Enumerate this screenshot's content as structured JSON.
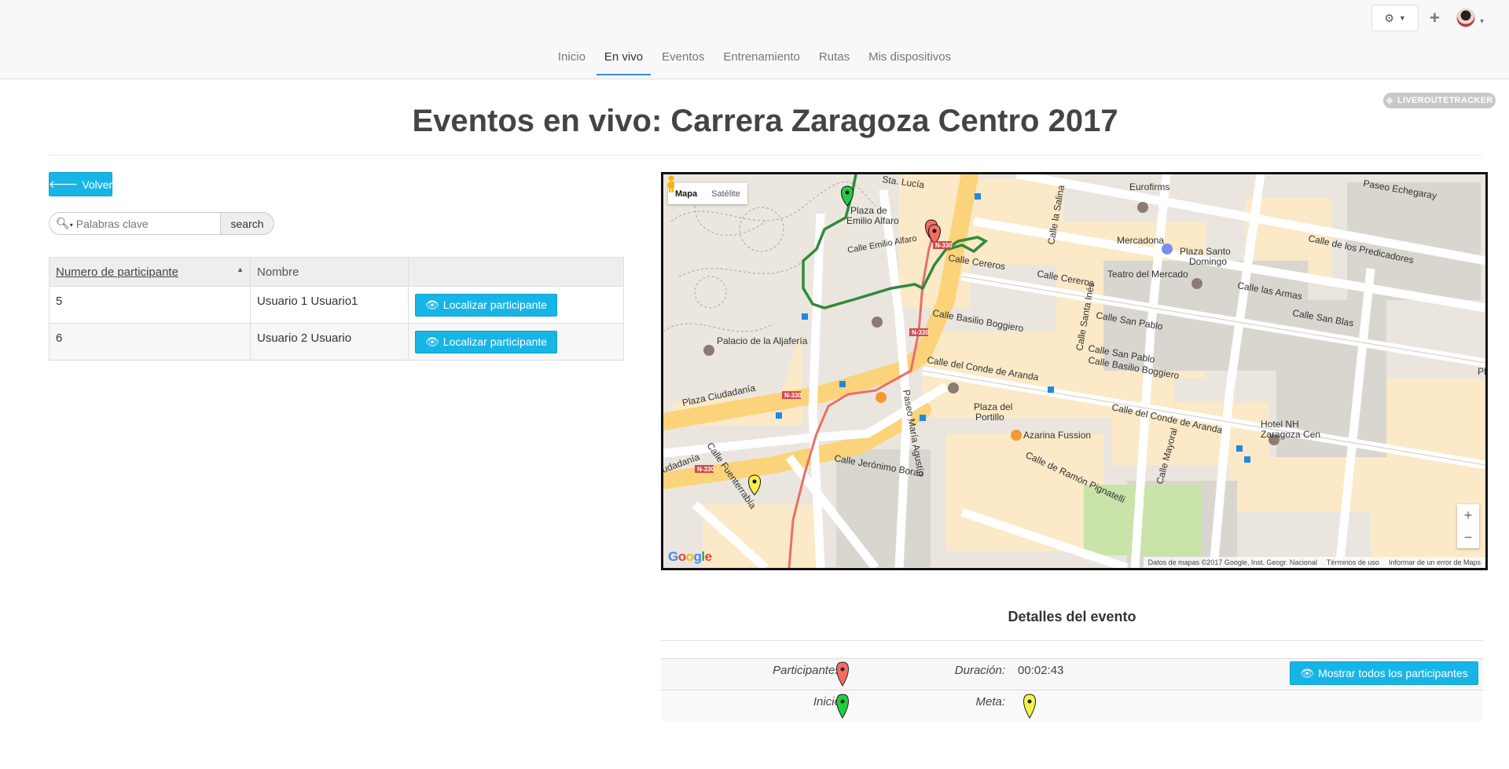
{
  "nav": {
    "items": [
      {
        "label": "Inicio",
        "active": false
      },
      {
        "label": "En vivo",
        "active": true
      },
      {
        "label": "Eventos",
        "active": false
      },
      {
        "label": "Entrenamiento",
        "active": false
      },
      {
        "label": "Rutas",
        "active": false
      },
      {
        "label": "Mis dispositivos",
        "active": false
      }
    ],
    "settings_icon": "gear-icon",
    "add_icon": "plus-icon"
  },
  "brand_badge": "LIVEROUTETRACKER",
  "page_title": "Eventos en vivo: Carrera Zaragoza Centro 2017",
  "back_button": "Volver",
  "search": {
    "placeholder": "Palabras clave",
    "button_label": "search"
  },
  "table": {
    "headers": [
      "Numero de participante",
      "Nombre",
      ""
    ],
    "sort_column": "Numero de participante",
    "rows": [
      {
        "number": "5",
        "name": "Usuario 1 Usuario1",
        "action": "Localizar participante"
      },
      {
        "number": "6",
        "name": "Usuario 2 Usuario",
        "action": "Localizar participante"
      }
    ]
  },
  "map": {
    "type_buttons": {
      "map": "Mapa",
      "satellite": "Satélite"
    },
    "labels": [
      "Sta. Lucía",
      "Eurofirms",
      "Paseo Echegaray",
      "Plaza de",
      "Emilio Alfaro",
      "Calle Emilio Alfaro",
      "Mercadona",
      "Plaza Santo",
      "Domingo",
      "Calle de los Predicadores",
      "Calle Cereros",
      "Calle Cereros",
      "Teatro del Mercado",
      "Calle las Armas",
      "Calle Basilio Boggiero",
      "Calle San Pablo",
      "Calle San Blas",
      "Palacio de la Aljafería",
      "Calle San Pablo",
      "Calle del Conde de Aranda",
      "Calle Basilio Boggiero",
      "Plaza Ciudadanía",
      "Paseo María Agustín",
      "Plaza del",
      "Portillo",
      "Calle del Conde de Aranda",
      "Azarina Fussion",
      "Hotel NH",
      "Zaragoza Cen",
      "Calle Fuenterrabía",
      "Calle Jerónimo Borao",
      "Calle de Ramón Pignatelli",
      "Calle Mayoral",
      "Calle Santa Inés",
      "Calle la Salina",
      "udadanía",
      "Pl"
    ],
    "road_badges": [
      "N-330",
      "N-330",
      "N-330",
      "N-330"
    ],
    "google": [
      "G",
      "o",
      "o",
      "g",
      "l",
      "e"
    ],
    "attribution": [
      "Datos de mapas ©2017 Google, Inst. Geogr. Nacional",
      "Términos de uso",
      "Informar de un error de Maps"
    ],
    "zoom_in": "+",
    "zoom_out": "−",
    "colors": {
      "participant_route": "#e8706a",
      "start_route": "#2f8a3c"
    }
  },
  "details": {
    "title": "Detalles del evento",
    "participants_label": "Participantes:",
    "duration_label": "Duración:",
    "duration_value": "00:02:43",
    "start_label": "Inicio:",
    "finish_label": "Meta:",
    "show_all_button": "Mostrar todos los participantes",
    "marker_colors": {
      "participants": "#f56c63",
      "start": "#22cc44",
      "finish": "#f5f14a"
    }
  }
}
